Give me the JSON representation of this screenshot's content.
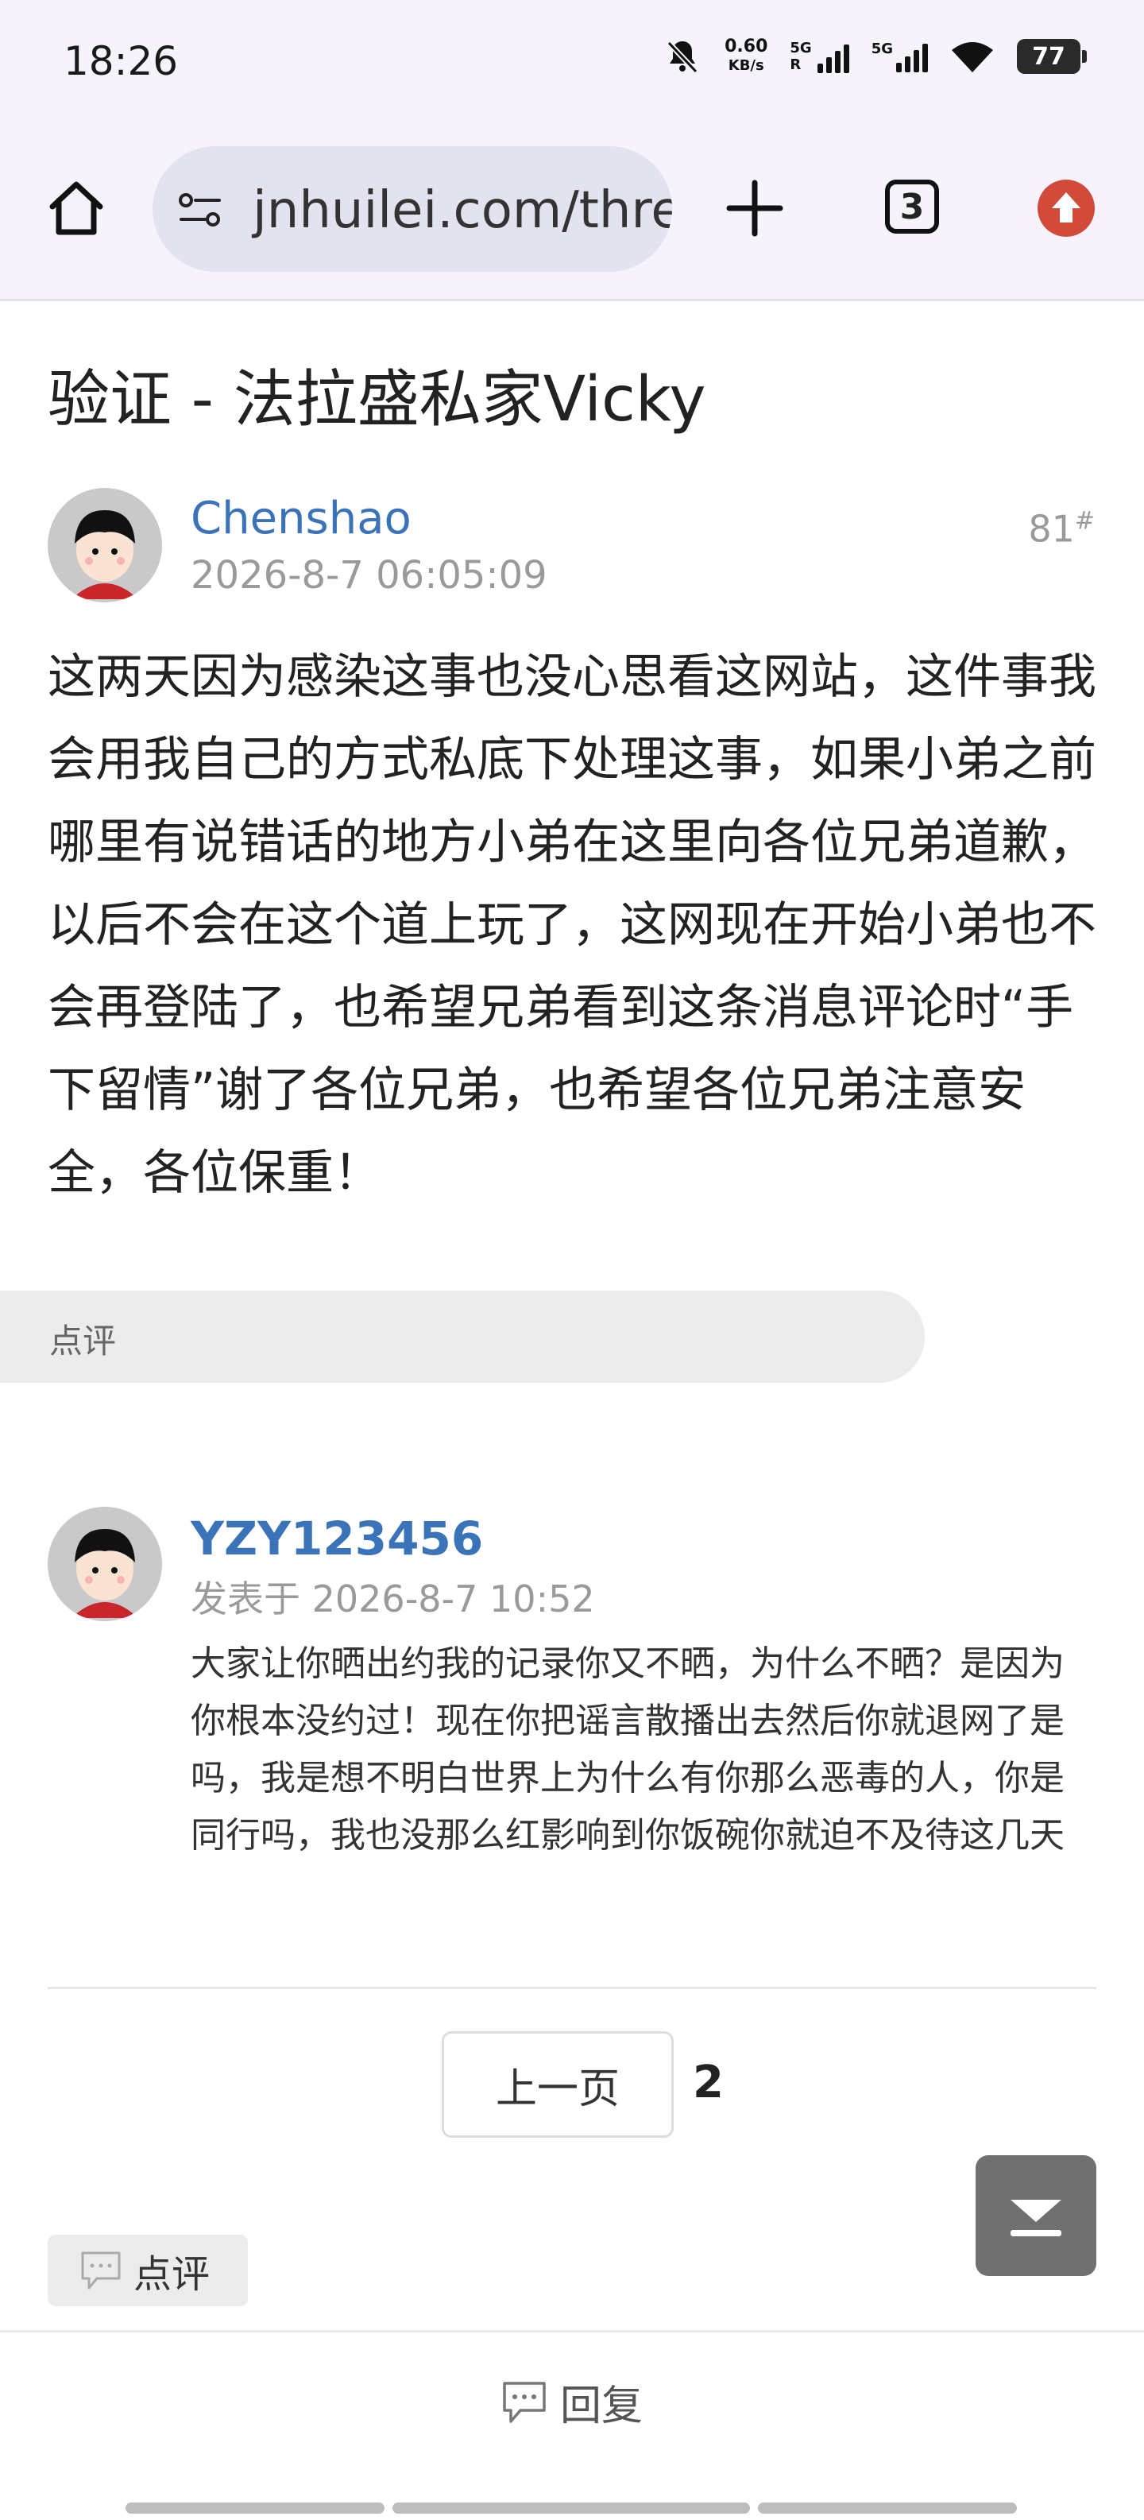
{
  "status_bar": {
    "time": "18:26",
    "net_speed_value": "0.60",
    "net_speed_unit": "KB/s",
    "sim1_label": "5G",
    "sim1_sub": "R",
    "sim2_label": "5G",
    "battery": "77"
  },
  "browser": {
    "url": "jnhuilei.com/thread",
    "tab_count": "3",
    "icons": [
      "home-icon",
      "site-settings-icon",
      "new-tab-icon",
      "tab-switcher-icon",
      "upload-icon"
    ],
    "accent_color": "#d14a3a"
  },
  "thread": {
    "title": "验证 - 法拉盛私家Vicky"
  },
  "post": {
    "author": "Chenshao",
    "date": "2026-8-7 06:05:09",
    "floor": "81",
    "floor_mark": "#",
    "body": "这两天因为感染这事也没心思看这网站，这件事我会用我自己的方式私底下处理这事，如果小弟之前哪里有说错话的地方小弟在这里向各位兄弟道歉，以后不会在这个道上玩了，这网现在开始小弟也不会再登陆了，也希望兄弟看到这条消息评论时“手下留情”谢了各位兄弟，也希望各位兄弟注意安全，各位保重！",
    "review_label": "点评"
  },
  "comment": {
    "author": "YZY123456",
    "date": "发表于 2026-8-7 10:52",
    "body": "大家让你晒出约我的记录你又不晒，为什么不晒？是因为你根本没约过！现在你把谣言散播出去然后你就退网了是吗，我是想不明白世界上为什么有你那么恶毒的人，你是同行吗，我也没那么红影响到你饭碗你就迫不及待这几天"
  },
  "pagination": {
    "prev_label": "上一页",
    "current_page": "2"
  },
  "actions": {
    "review_label": "点评",
    "reply_label": "回复"
  }
}
